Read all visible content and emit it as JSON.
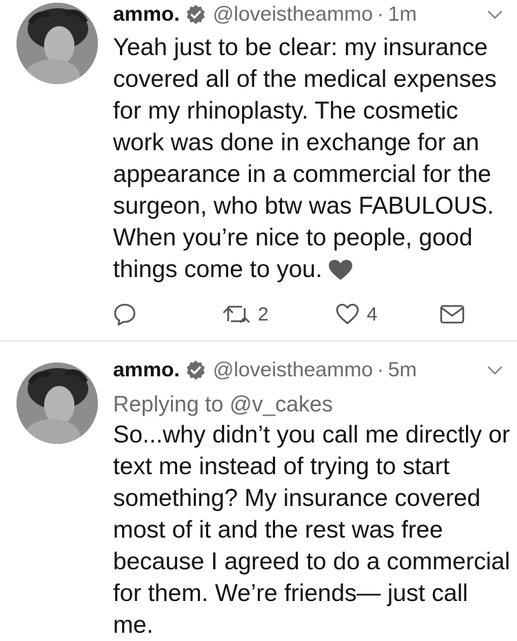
{
  "tweets": [
    {
      "author": {
        "name": "ammo.",
        "handle": "@loveistheammo",
        "verified": true
      },
      "time": "1m",
      "text": "Yeah just to be clear: my insurance covered all of the medical expenses for my rhinoplasty. The cosmetic work was done in exchange for an appearance in a commercial for the surgeon, who btw was FABULOUS. When you’re nice to people, good things come to you.",
      "emoji": "grey-heart",
      "actions": {
        "retweets": "2",
        "likes": "4"
      }
    },
    {
      "author": {
        "name": "ammo.",
        "handle": "@loveistheammo",
        "verified": true
      },
      "time": "5m",
      "replying_to": "Replying to @v_cakes",
      "text": "So...why didn’t you call me directly or text me instead of trying to start something? My insurance covered most of it and the rest was free because I agreed to do a commercial for them. We’re friends— just call me."
    }
  ],
  "separator": "·",
  "colors": {
    "text": "#111111",
    "secondary": "#6b6b6b",
    "icon": "#555555",
    "divider": "#e6e6e6"
  },
  "icons": {
    "verified": "verified-badge-icon",
    "more": "chevron-down-icon",
    "reply": "reply-bubble-icon",
    "retweet": "retweet-icon",
    "like": "heart-outline-icon",
    "message": "envelope-icon"
  }
}
